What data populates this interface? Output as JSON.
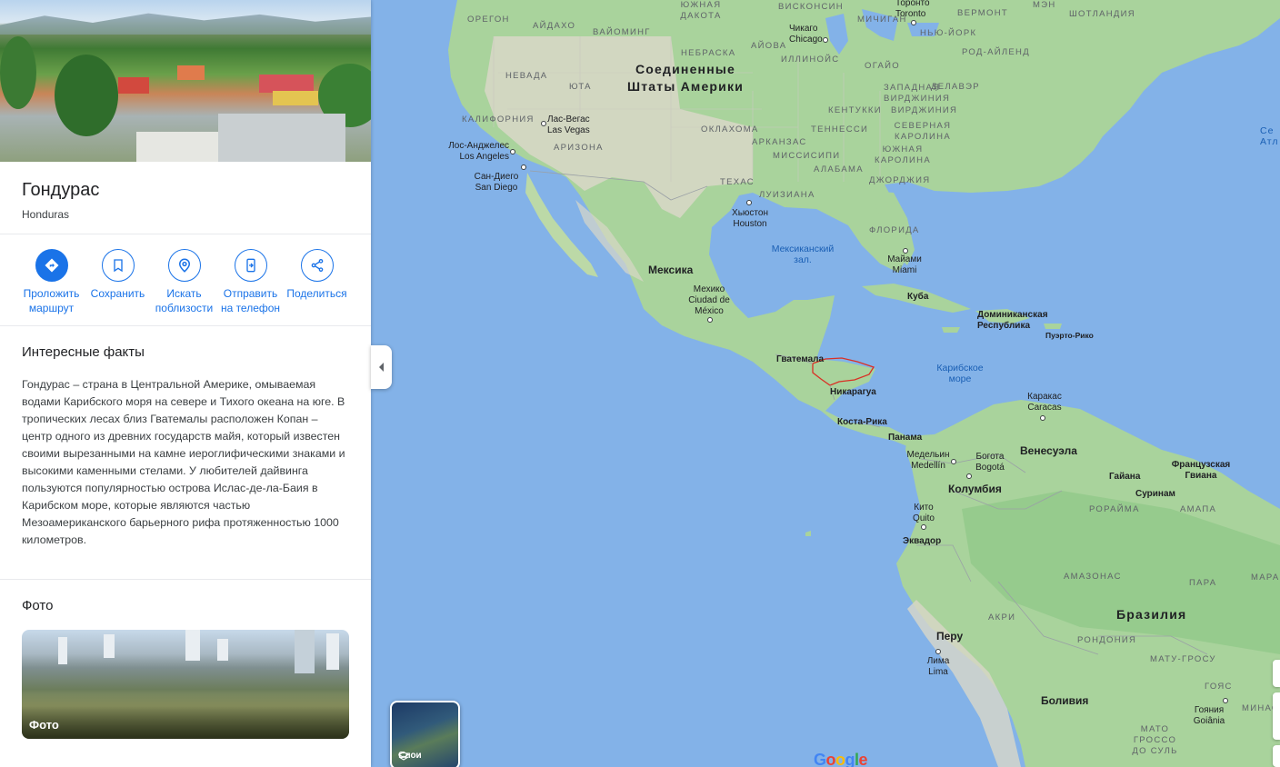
{
  "place": {
    "name": "Гондурас",
    "subtitle": "Honduras"
  },
  "actions": [
    {
      "label": "Проложить маршрут",
      "icon": "directions-icon"
    },
    {
      "label": "Сохранить",
      "icon": "bookmark-icon"
    },
    {
      "label": "Искать поблизости",
      "icon": "nearby-icon"
    },
    {
      "label": "Отправить на телефон",
      "icon": "send-to-phone-icon"
    },
    {
      "label": "Поделиться",
      "icon": "share-icon"
    }
  ],
  "facts": {
    "title": "Интересные факты",
    "text": "Гондурас – страна в Центральной Америке, омываемая водами Карибского моря на севере и Тихого океана на юге. В тропических лесах близ Гватемалы расположен Копан – центр одного из древних государств майя, который известен своими вырезанными на камне иероглифическими знаками и высокими каменными стелами. У любителей дайвинга пользуются популярностью острова Ислас-де-ла-Баия в Карибском море, которые являются частью Мезоамериканского барьерного рифа протяженностью 1000 километров."
  },
  "photos": {
    "title": "Фото",
    "card_caption": "Фото"
  },
  "layers_label": "Слои",
  "map": {
    "states": [
      "ОРЕГОН",
      "АЙДАХО",
      "ВАЙОМИНГ",
      "ЮЖНАЯ ДАКОТА",
      "НЕБРАСКА",
      "АЙОВА",
      "ИЛЛИНОЙС",
      "ВИСКОНСИН",
      "МИЧИГАН",
      "НЕВАДА",
      "ЮТА",
      "КАЛИФОРНИЯ",
      "АРИЗОНА",
      "ОКЛАХОМА",
      "АРКАНЗАС",
      "ТЕННЕССИ",
      "МИССИСИПИ",
      "АЛАБАМА",
      "ДЖОРДЖИЯ",
      "ТЕХАС",
      "ЛУИЗИАНА",
      "ФЛОРИДА",
      "ОГАЙО",
      "ЗАПАДНАЯ ВИРДЖИНИЯ",
      "ВИРДЖИНИЯ",
      "КЕНТУККИ",
      "СЕВЕРНАЯ КАРОЛИНА",
      "ЮЖНАЯ КАРОЛИНА",
      "ДЕЛАВЭР",
      "НЬЮ-ЙОРК",
      "ВЕРМОНТ",
      "РОД-АЙЛЕНД",
      "МЭН",
      "ШОТЛАНДИЯ",
      "РОРАЙМА",
      "АМАПА",
      "АМАЗОНАС",
      "ПАРА",
      "МАРАНЬ",
      "АКРИ",
      "РОНДОНИЯ",
      "МАТУ-ГРОСУ",
      "ГОЯС",
      "МИНАС",
      "МАТО ГРОССО ДО СУЛЬ"
    ],
    "countries": [
      "Соединенные Штаты Америки",
      "Мексика",
      "Гватемала",
      "Никарагуа",
      "Коста-Рика",
      "Панама",
      "Куба",
      "Доминиканская Республика",
      "Пуэрто-Рико",
      "Венесуэла",
      "Колумбия",
      "Эквадор",
      "Перу",
      "Бразилия",
      "Боливия",
      "Гайана",
      "Суринам",
      "Французская Гвиана"
    ],
    "cities": [
      "Чикаго Chicago",
      "Торонто Toronto",
      "Лас-Вегас Las Vegas",
      "Лос-Анджелес Los Angeles",
      "Сан-Диего San Diego",
      "Хьюстон Houston",
      "Майами Miami",
      "Мехико Ciudad de México",
      "Каракас Caracas",
      "Медельин Medellín",
      "Богота Bogotá",
      "Кито Quito",
      "Лима Lima",
      "Гояния Goiânia"
    ],
    "waters": [
      "Мексиканский зал.",
      "Карибское море",
      "Се Атл"
    ],
    "colors": {
      "water": "#83b2e8",
      "land": "#a9d39c",
      "land_dry": "#d9d7c8",
      "highlight_border": "#d93025"
    }
  },
  "attribution": "Google"
}
